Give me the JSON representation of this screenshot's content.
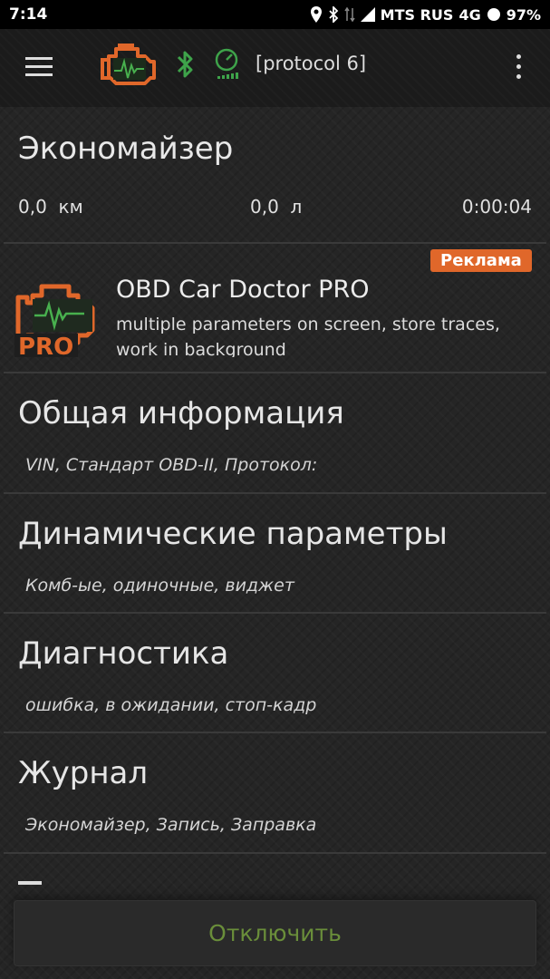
{
  "status_bar": {
    "time": "7:14",
    "carrier": "MTS RUS",
    "network": "4G",
    "battery": "97%"
  },
  "toolbar": {
    "protocol": "[protocol 6]"
  },
  "economizer": {
    "title": "Экономайзер",
    "distance": "0,0  км",
    "fuel": "0,0  л",
    "time": "0:00:04"
  },
  "ad": {
    "badge": "Реклама",
    "logo_text": "PRO",
    "title": "OBD Car Doctor PRO",
    "description": "multiple parameters on screen, store traces, work in background"
  },
  "sections": [
    {
      "title": "Общая информация",
      "subtitle": "VIN, Стандарт OBD-II, Протокол:"
    },
    {
      "title": "Динамические параметры",
      "subtitle": "Комб-ые, одиночные, виджет"
    },
    {
      "title": "Диагностика",
      "subtitle": "ошибка, в ожидании, стоп-кадр"
    },
    {
      "title": "Журнал",
      "subtitle": "Экономайзер, Запись, Заправка"
    }
  ],
  "disconnect_button": "Отключить",
  "colors": {
    "accent_orange": "#e0672a",
    "accent_green": "#3ea34a",
    "button_text": "#6a8e3a",
    "background": "#252525"
  },
  "icons": [
    "hamburger-menu-icon",
    "engine-check-icon",
    "bluetooth-icon",
    "gauge-icon",
    "more-vert-icon"
  ]
}
